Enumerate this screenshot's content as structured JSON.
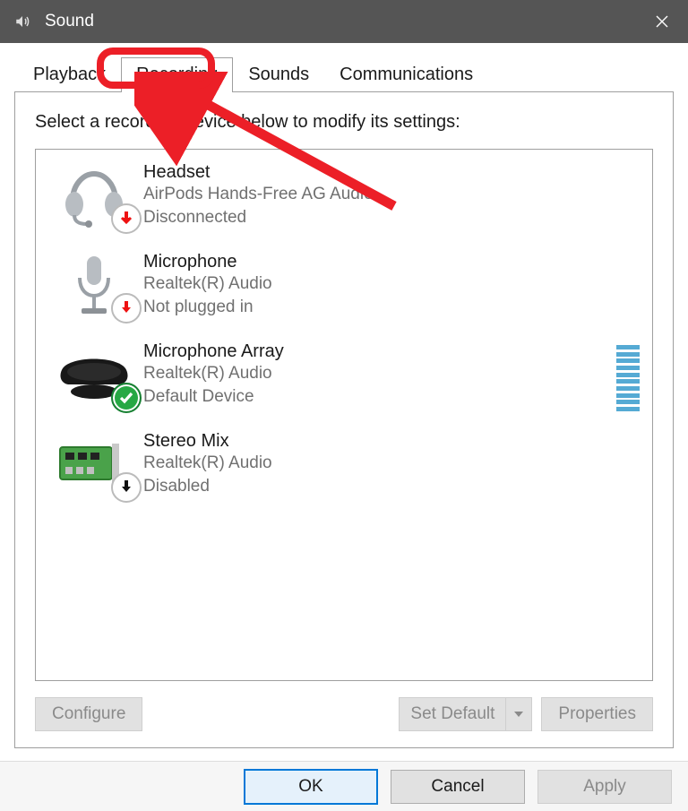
{
  "title": "Sound",
  "tabs": {
    "playback": "Playback",
    "recording": "Recording",
    "sounds": "Sounds",
    "communications": "Communications",
    "active_index": 1
  },
  "panel": {
    "caption": "Select a recording device below to modify its settings:"
  },
  "devices": [
    {
      "name": "Headset",
      "sub1": "AirPods Hands-Free AG Audio",
      "sub2": "Disconnected",
      "icon": "headset",
      "badge": "red-down",
      "level_meter": false
    },
    {
      "name": "Microphone",
      "sub1": "Realtek(R) Audio",
      "sub2": "Not plugged in",
      "icon": "microphone",
      "badge": "red-down",
      "level_meter": false
    },
    {
      "name": "Microphone Array",
      "sub1": "Realtek(R) Audio",
      "sub2": "Default Device",
      "icon": "mic-array",
      "badge": "green-check",
      "level_meter": true
    },
    {
      "name": "Stereo Mix",
      "sub1": "Realtek(R) Audio",
      "sub2": "Disabled",
      "icon": "stereo-mix",
      "badge": "black-down",
      "level_meter": false
    }
  ],
  "panel_buttons": {
    "configure": "Configure",
    "set_default": "Set Default",
    "properties": "Properties"
  },
  "dialog_buttons": {
    "ok": "OK",
    "cancel": "Cancel",
    "apply": "Apply"
  },
  "annotation": {
    "highlight_tab_index": 1
  }
}
